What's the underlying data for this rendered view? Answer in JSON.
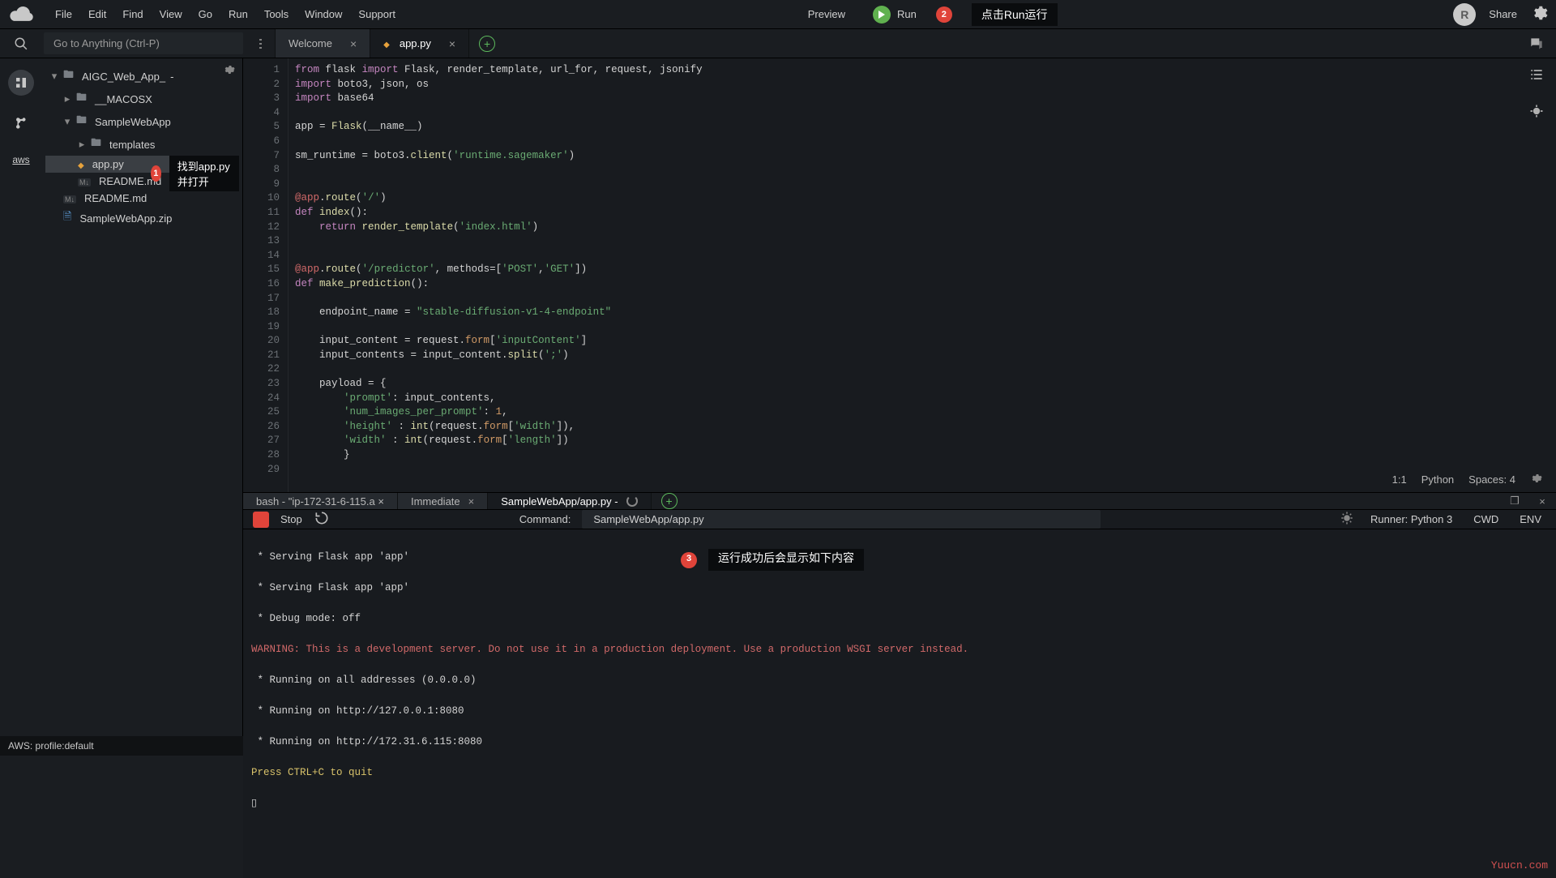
{
  "menu": {
    "items": [
      "File",
      "Edit",
      "Find",
      "View",
      "Go",
      "Run",
      "Tools",
      "Window",
      "Support"
    ],
    "preview": "Preview",
    "run": "Run",
    "share": "Share",
    "avatar_initial": "R"
  },
  "goto": {
    "placeholder": "Go to Anything (Ctrl-P)"
  },
  "callouts": {
    "c1_num": "1",
    "c1_text": "找到app.py并打开",
    "c2_num": "2",
    "c2_text": "点击Run运行",
    "c3_num": "3",
    "c3_text": "运行成功后会显示如下内容"
  },
  "tabs": {
    "welcome": "Welcome",
    "app": "app.py"
  },
  "tree": {
    "root": "AIGC_Web_App_",
    "items": [
      {
        "indent": 1,
        "chev": "right",
        "icon": "folder",
        "label": "__MACOSX"
      },
      {
        "indent": 1,
        "chev": "down",
        "icon": "folder",
        "label": "SampleWebApp"
      },
      {
        "indent": 2,
        "chev": "right",
        "icon": "folder",
        "label": "templates"
      },
      {
        "indent": 2,
        "chev": "",
        "icon": "py",
        "label": "app.py",
        "selected": true
      },
      {
        "indent": 2,
        "chev": "",
        "icon": "md",
        "label": "README.md"
      },
      {
        "indent": 1,
        "chev": "",
        "icon": "md",
        "label": "README.md"
      },
      {
        "indent": 1,
        "chev": "",
        "icon": "zip",
        "label": "SampleWebApp.zip"
      }
    ]
  },
  "aws_label": "aws",
  "code_lines": [
    [
      [
        "kw",
        "from"
      ],
      [
        "op",
        " flask "
      ],
      [
        "kw",
        "import"
      ],
      [
        "op",
        " Flask, render_template, url_for, request, jsonify"
      ]
    ],
    [
      [
        "kw",
        "import"
      ],
      [
        "op",
        " boto3, json, os"
      ]
    ],
    [
      [
        "kw",
        "import"
      ],
      [
        "op",
        " base64"
      ]
    ],
    [],
    [
      [
        "op",
        "app = "
      ],
      [
        "fn",
        "Flask"
      ],
      [
        "op",
        "(__name__)"
      ]
    ],
    [],
    [
      [
        "op",
        "sm_runtime = boto3."
      ],
      [
        "fn",
        "client"
      ],
      [
        "op",
        "("
      ],
      [
        "str",
        "'runtime.sagemaker'"
      ],
      [
        "op",
        ")"
      ]
    ],
    [],
    [],
    [
      [
        "dec",
        "@app"
      ],
      [
        "op",
        "."
      ],
      [
        "fn",
        "route"
      ],
      [
        "op",
        "("
      ],
      [
        "str",
        "'/'"
      ],
      [
        "op",
        ")"
      ]
    ],
    [
      [
        "kw",
        "def"
      ],
      [
        "op",
        " "
      ],
      [
        "fn",
        "index"
      ],
      [
        "op",
        "():"
      ]
    ],
    [
      [
        "op",
        "    "
      ],
      [
        "kw",
        "return"
      ],
      [
        "op",
        " "
      ],
      [
        "fn",
        "render_template"
      ],
      [
        "op",
        "("
      ],
      [
        "str",
        "'index.html'"
      ],
      [
        "op",
        ")"
      ]
    ],
    [],
    [],
    [
      [
        "dec",
        "@app"
      ],
      [
        "op",
        "."
      ],
      [
        "fn",
        "route"
      ],
      [
        "op",
        "("
      ],
      [
        "str",
        "'/predictor'"
      ],
      [
        "op",
        ", methods=["
      ],
      [
        "str",
        "'POST'"
      ],
      [
        "op",
        ","
      ],
      [
        "str",
        "'GET'"
      ],
      [
        "op",
        "])"
      ]
    ],
    [
      [
        "kw",
        "def"
      ],
      [
        "op",
        " "
      ],
      [
        "fn",
        "make_prediction"
      ],
      [
        "op",
        "():"
      ]
    ],
    [],
    [
      [
        "op",
        "    endpoint_name = "
      ],
      [
        "str",
        "\"stable-diffusion-v1-4-endpoint\""
      ]
    ],
    [],
    [
      [
        "op",
        "    input_content = request."
      ],
      [
        "orange",
        "form"
      ],
      [
        "op",
        "["
      ],
      [
        "str",
        "'inputContent'"
      ],
      [
        "op",
        "]"
      ]
    ],
    [
      [
        "op",
        "    input_contents = input_content."
      ],
      [
        "fn",
        "split"
      ],
      [
        "op",
        "("
      ],
      [
        "str",
        "';'"
      ],
      [
        "op",
        ")"
      ]
    ],
    [],
    [
      [
        "op",
        "    payload = {"
      ]
    ],
    [
      [
        "op",
        "        "
      ],
      [
        "str",
        "'prompt'"
      ],
      [
        "op",
        ": input_contents,"
      ]
    ],
    [
      [
        "op",
        "        "
      ],
      [
        "str",
        "'num_images_per_prompt'"
      ],
      [
        "op",
        ": "
      ],
      [
        "orange",
        "1"
      ],
      [
        "op",
        ","
      ]
    ],
    [
      [
        "op",
        "        "
      ],
      [
        "str",
        "'height'"
      ],
      [
        "op",
        " : "
      ],
      [
        "fn",
        "int"
      ],
      [
        "op",
        "(request."
      ],
      [
        "orange",
        "form"
      ],
      [
        "op",
        "["
      ],
      [
        "str",
        "'width'"
      ],
      [
        "op",
        "]),"
      ]
    ],
    [
      [
        "op",
        "        "
      ],
      [
        "str",
        "'width'"
      ],
      [
        "op",
        " : "
      ],
      [
        "fn",
        "int"
      ],
      [
        "op",
        "(request."
      ],
      [
        "orange",
        "form"
      ],
      [
        "op",
        "["
      ],
      [
        "str",
        "'length'"
      ],
      [
        "op",
        "])"
      ]
    ],
    [
      [
        "op",
        "        }"
      ]
    ],
    []
  ],
  "editor_status": {
    "pos": "1:1",
    "lang": "Python",
    "spaces": "Spaces: 4"
  },
  "bottom_tabs": {
    "bash": "bash - \"ip-172-31-6-115.a ×",
    "immediate": "Immediate",
    "running": "SampleWebApp/app.py -"
  },
  "runbar": {
    "stop": "Stop",
    "command_label": "Command:",
    "command_value": "SampleWebApp/app.py",
    "runner": "Runner: Python 3",
    "cwd": "CWD",
    "env": "ENV"
  },
  "console": {
    "l1": " * Serving Flask app 'app'",
    "l2": " * Serving Flask app 'app'",
    "l3": " * Debug mode: off",
    "warn": "WARNING: This is a development server. Do not use it in a production deployment. Use a production WSGI server instead.",
    "l5": " * Running on all addresses (0.0.0.0)",
    "l6": " * Running on http://127.0.0.1:8080",
    "l7": " * Running on http://172.31.6.115:8080",
    "press": "Press CTRL+C to quit",
    "cursor": "▯"
  },
  "statusbar": "AWS: profile:default",
  "watermark": "Yuucn.com"
}
